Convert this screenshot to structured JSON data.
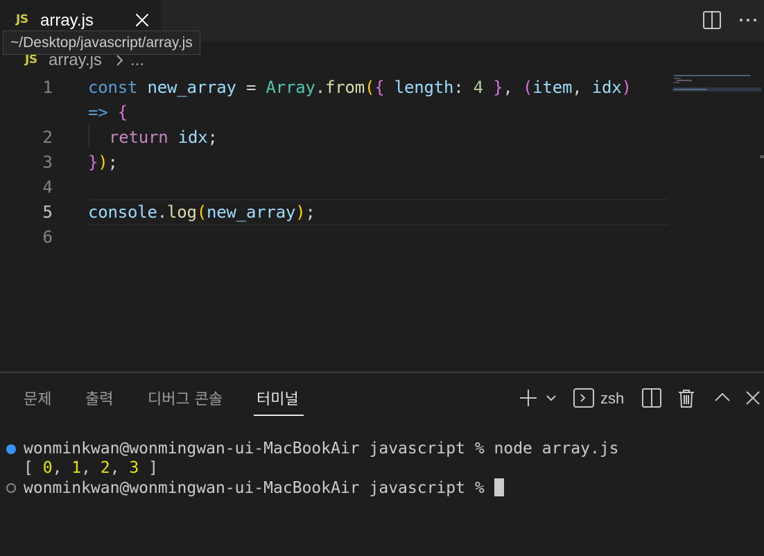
{
  "tab": {
    "icon_label": "JS",
    "filename": "array.js"
  },
  "tooltip": {
    "text": "~/Desktop/javascript/array.js"
  },
  "breadcrumb": {
    "icon_label": "JS",
    "file": "array.js",
    "ellipsis": "..."
  },
  "editor": {
    "line_numbers": [
      "1",
      "2",
      "3",
      "4",
      "5",
      "6"
    ],
    "active_line": "5",
    "code": {
      "l1_const": "const",
      "l1_name": "new_array",
      "l1_eq": " = ",
      "l1_class": "Array",
      "l1_dot": ".",
      "l1_from": "from",
      "l1_open": "(",
      "l1_brace_open": "{",
      "l1_length": " length",
      "l1_colon": ": ",
      "l1_num": "4",
      "l1_brace_close": "}",
      "l1_comma": ", ",
      "l1_paren_open": "(",
      "l1_item": "item",
      "l1_comma2": ", ",
      "l1_idx": "idx",
      "l1_paren_close": ")",
      "l1w_arrow": "=>",
      "l1w_brace": "{",
      "l2_return": "return",
      "l2_idx": "idx",
      "l2_semi": ";",
      "l3_brace": "}",
      "l3_paren": ")",
      "l3_semi": ";",
      "l5_console": "console",
      "l5_dot": ".",
      "l5_log": "log",
      "l5_open": "(",
      "l5_arg": "new_array",
      "l5_close": ")",
      "l5_semi": ";"
    }
  },
  "panel": {
    "tabs": [
      "문제",
      "출력",
      "디버그 콘솔",
      "터미널"
    ],
    "active_tab": "터미널",
    "shell_label": "zsh"
  },
  "terminal": {
    "prompt": "wonminkwan@wonmingwan-ui-MacBookAir javascript % ",
    "command": "node array.js",
    "output_open": "[ ",
    "output_values": [
      "0",
      "1",
      "2",
      "3"
    ],
    "output_close": " ]"
  },
  "colors": {
    "keyword": "#569cd6",
    "variable": "#9cdcfe",
    "class": "#4ec9b0",
    "function": "#dcdcaa",
    "number": "#b5cea8",
    "control": "#c586c0",
    "js_icon": "#cbcb41",
    "terminal_dot": "#3794ff"
  }
}
